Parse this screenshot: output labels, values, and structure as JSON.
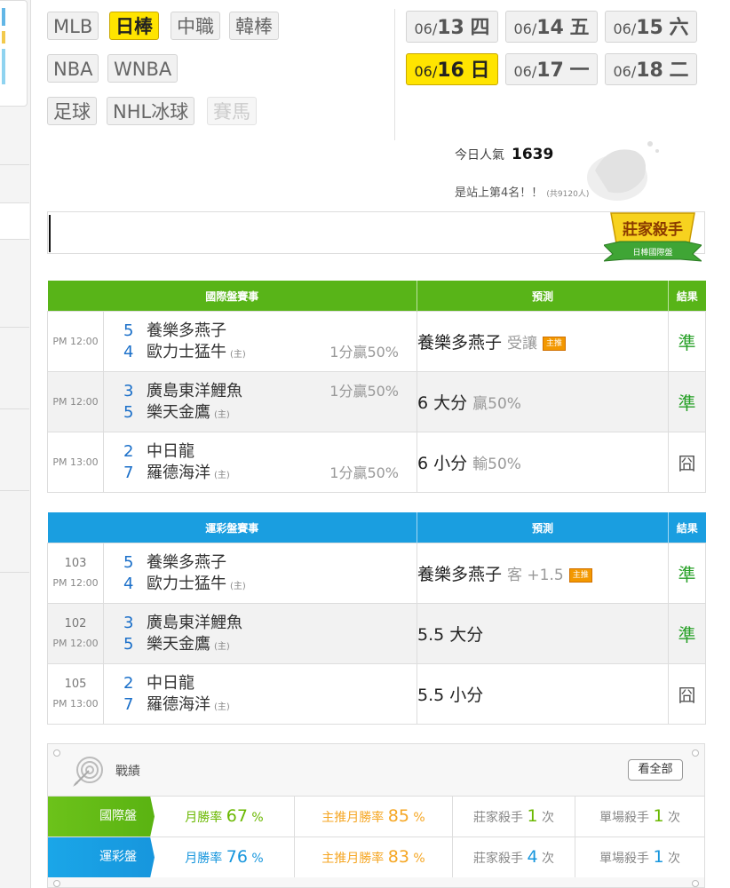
{
  "leagues": [
    {
      "label": "MLB",
      "state": "normal"
    },
    {
      "label": "日棒",
      "state": "active"
    },
    {
      "label": "中職",
      "state": "normal"
    },
    {
      "label": "韓棒",
      "state": "normal"
    },
    {
      "label": "NBA",
      "state": "normal"
    },
    {
      "label": "WNBA",
      "state": "normal"
    },
    {
      "label": "足球",
      "state": "normal"
    },
    {
      "label": "NHL冰球",
      "state": "normal"
    },
    {
      "label": "賽馬",
      "state": "disabled"
    }
  ],
  "dates": [
    {
      "month": "06/",
      "day": "13",
      "weekday": "四",
      "active": false
    },
    {
      "month": "06/",
      "day": "14",
      "weekday": "五",
      "active": false
    },
    {
      "month": "06/",
      "day": "15",
      "weekday": "六",
      "active": false
    },
    {
      "month": "06/",
      "day": "16",
      "weekday": "日",
      "active": true
    },
    {
      "month": "06/",
      "day": "17",
      "weekday": "一",
      "active": false
    },
    {
      "month": "06/",
      "day": "18",
      "weekday": "二",
      "active": false
    }
  ],
  "popularity": {
    "label": "今日人氣",
    "value": "1639",
    "rank_text": "是站上第4名！！",
    "total": "(共9120人)"
  },
  "badge": {
    "title": "莊家殺手",
    "subtitle": "日棒國際盤"
  },
  "intl": {
    "header": "國際盤賽事",
    "pred_header": "預測",
    "result_header": "結果",
    "rows": [
      {
        "time": "PM 12:00",
        "away_score": "5",
        "away": "養樂多燕子",
        "home_score": "4",
        "home": "歐力士猛牛",
        "host": "(主)",
        "hcp": "1分贏50%",
        "hcp_row": "home",
        "pick": "養樂多燕子",
        "pick_sub": "受讓",
        "push": "主推",
        "result": "準",
        "result_type": "win"
      },
      {
        "time": "PM 12:00",
        "away_score": "3",
        "away": "廣島東洋鯉魚",
        "home_score": "5",
        "home": "樂天金鷹",
        "host": "(主)",
        "hcp": "1分贏50%",
        "hcp_row": "away",
        "pick": "6 大分",
        "pick_sub": "贏50%",
        "push": "",
        "result": "準",
        "result_type": "win"
      },
      {
        "time": "PM 13:00",
        "away_score": "2",
        "away": "中日龍",
        "home_score": "7",
        "home": "羅德海洋",
        "host": "(主)",
        "hcp": "1分贏50%",
        "hcp_row": "home",
        "pick": "6 小分",
        "pick_sub": "輸50%",
        "push": "",
        "result": "囧",
        "result_type": "mid"
      }
    ]
  },
  "lottery": {
    "header": "運彩盤賽事",
    "pred_header": "預測",
    "result_header": "結果",
    "rows": [
      {
        "code": "103",
        "time": "PM 12:00",
        "away_score": "5",
        "away": "養樂多燕子",
        "home_score": "4",
        "home": "歐力士猛牛",
        "host": "(主)",
        "pick": "養樂多燕子",
        "pick_sub": "客 +1.5",
        "push": "主推",
        "result": "準",
        "result_type": "win"
      },
      {
        "code": "102",
        "time": "PM 12:00",
        "away_score": "3",
        "away": "廣島東洋鯉魚",
        "home_score": "5",
        "home": "樂天金鷹",
        "host": "(主)",
        "pick": "5.5 大分",
        "pick_sub": "",
        "push": "",
        "result": "準",
        "result_type": "win"
      },
      {
        "code": "105",
        "time": "PM 13:00",
        "away_score": "2",
        "away": "中日龍",
        "home_score": "7",
        "home": "羅德海洋",
        "host": "(主)",
        "pick": "5.5 小分",
        "pick_sub": "",
        "push": "",
        "result": "囧",
        "result_type": "mid"
      }
    ]
  },
  "stats": {
    "title": "戰績",
    "more_label": "看全部",
    "rows": [
      {
        "label": "國際盤",
        "color": "green",
        "month_label": "月勝率",
        "month_rate": "67",
        "pct": "%",
        "push_label": "主推月勝率",
        "push_rate": "85",
        "banker_label": "莊家殺手",
        "banker_count": "1",
        "times": "次",
        "single_label": "單場殺手",
        "single_count": "1"
      },
      {
        "label": "運彩盤",
        "color": "blue",
        "month_label": "月勝率",
        "month_rate": "76",
        "pct": "%",
        "push_label": "主推月勝率",
        "push_rate": "83",
        "banker_label": "莊家殺手",
        "banker_count": "4",
        "times": "次",
        "single_label": "單場殺手",
        "single_count": "1"
      }
    ]
  },
  "colors": {
    "green_header": "#58b418",
    "blue_header": "#1a9ee0",
    "active_yellow": "#ffe400",
    "win_green": "#27a027",
    "score_blue": "#1a6fc9",
    "push_orange": "#f39800"
  }
}
